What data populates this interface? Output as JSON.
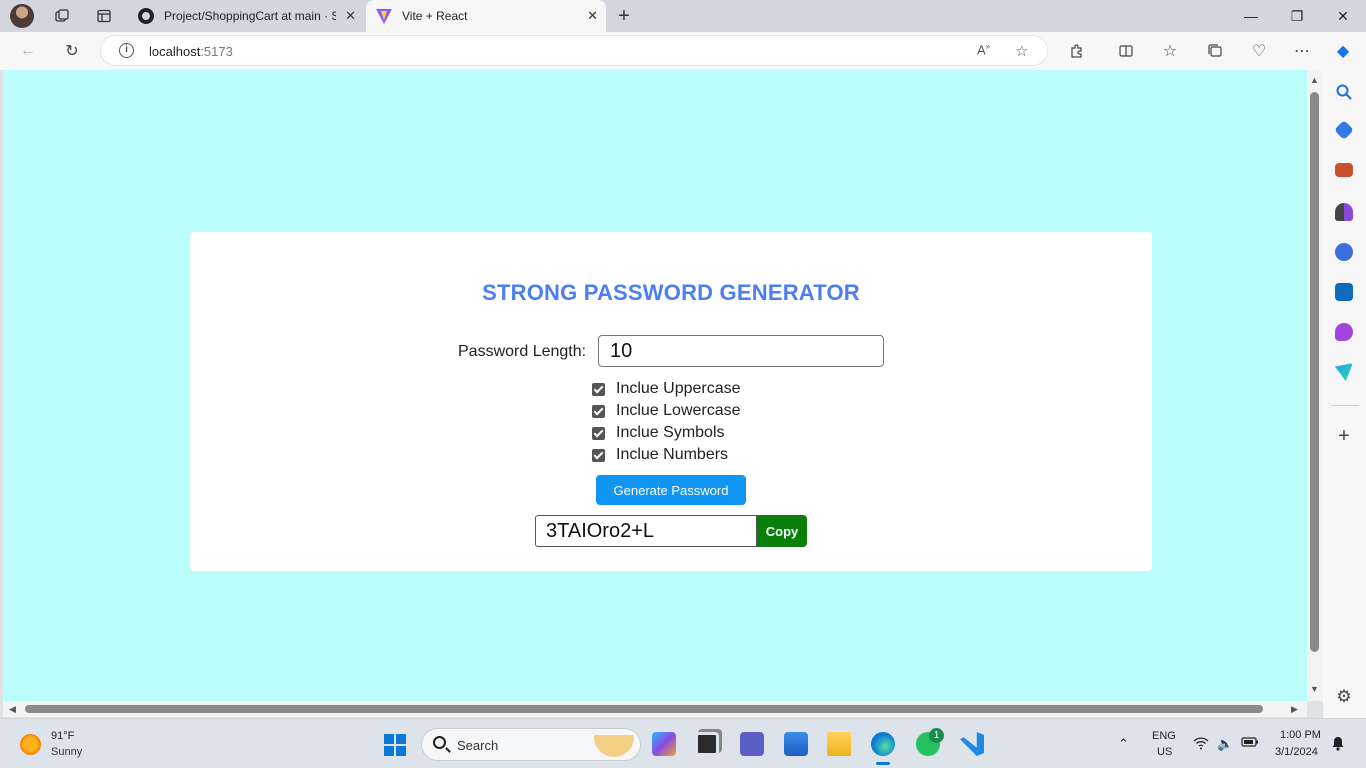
{
  "browser": {
    "tabs": [
      {
        "title": "Project/ShoppingCart at main · S",
        "favicon": "github-icon",
        "active": false
      },
      {
        "title": "Vite + React",
        "favicon": "vite-icon",
        "active": true
      }
    ],
    "new_tab": "+",
    "window_controls": {
      "minimize": "—",
      "restore": "❐",
      "close": "✕"
    },
    "address": {
      "host": "localhost",
      "port": ":5173"
    }
  },
  "app": {
    "title": "STRONG PASSWORD GENERATOR",
    "length_label": "Password Length:",
    "length_value": "10",
    "options": [
      {
        "label": "Inclue Uppercase",
        "checked": true
      },
      {
        "label": "Inclue Lowercase",
        "checked": true
      },
      {
        "label": "Inclue Symbols",
        "checked": true
      },
      {
        "label": "Inclue Numbers",
        "checked": true
      }
    ],
    "generate_label": "Generate Password",
    "password": "3TAIOro2+L",
    "copy_label": "Copy",
    "colors": {
      "page_bg": "#bbfdfb",
      "title": "#4d7ff0",
      "generate": "#0f96f3",
      "copy": "#0b7f0b"
    }
  },
  "taskbar": {
    "weather": {
      "temp": "91°F",
      "condition": "Sunny"
    },
    "search_label": "Search",
    "lang": {
      "line1": "ENG",
      "line2": "US"
    },
    "clock": {
      "time": "1:00 PM",
      "date": "3/1/2024"
    },
    "whatsapp_badge": "1"
  }
}
